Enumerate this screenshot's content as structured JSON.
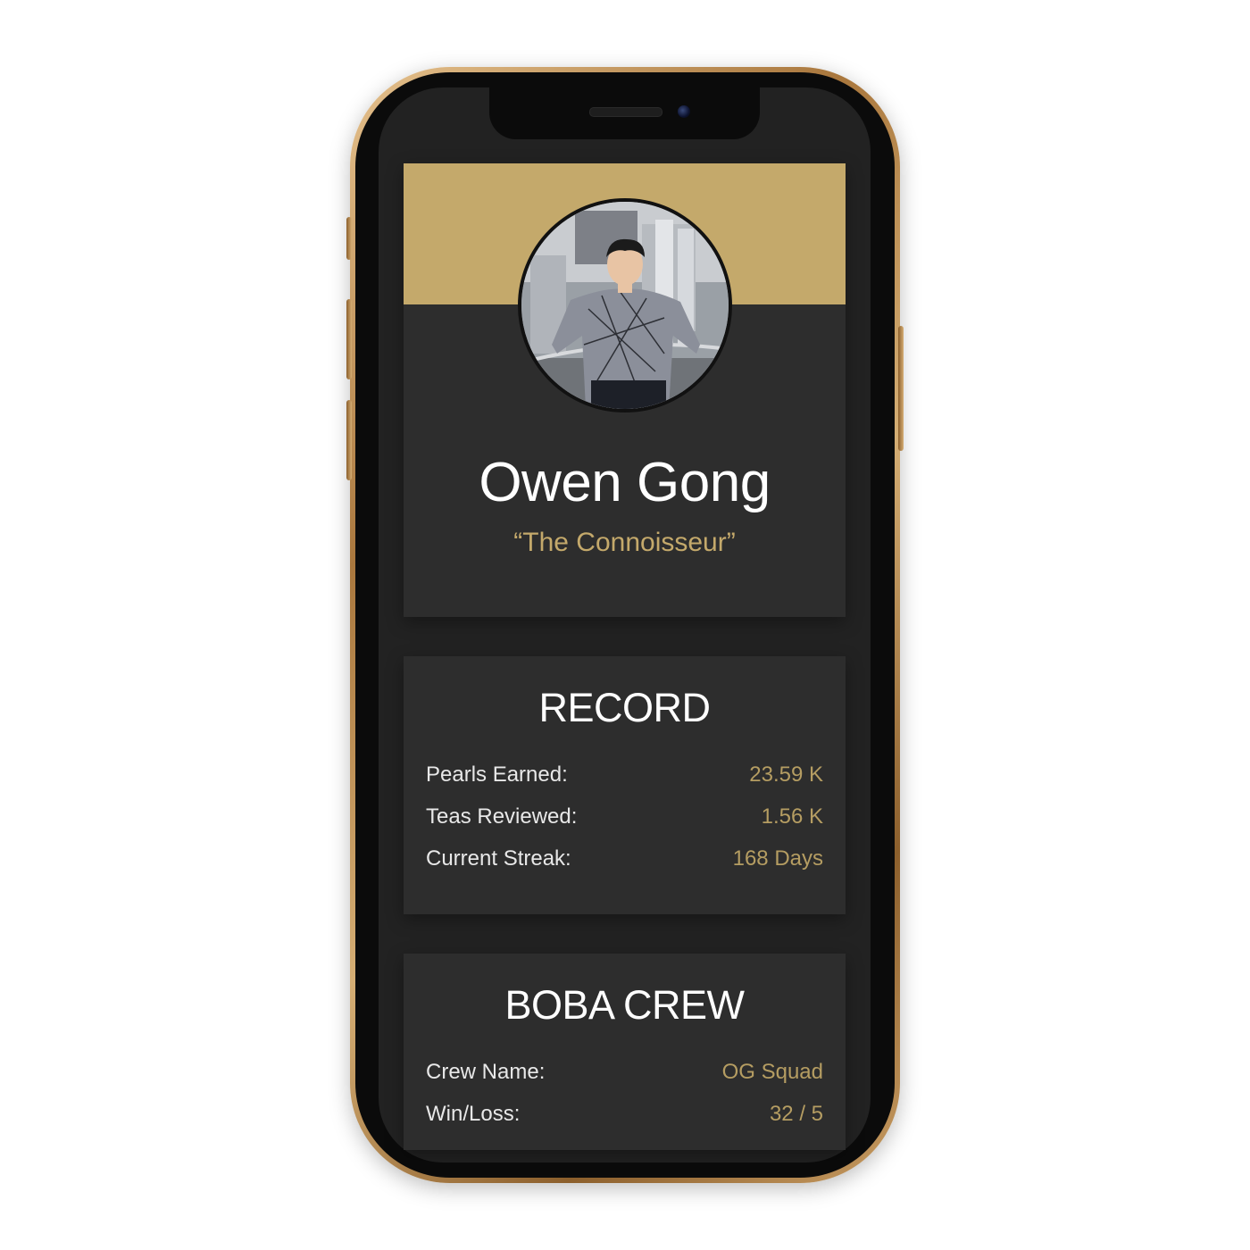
{
  "profile": {
    "name": "Owen Gong",
    "title": "“The Connoisseur”"
  },
  "record": {
    "heading": "RECORD",
    "stats": [
      {
        "label": "Pearls Earned:",
        "value": "23.59 K"
      },
      {
        "label": "Teas Reviewed:",
        "value": "1.56 K"
      },
      {
        "label": "Current Streak:",
        "value": "168 Days"
      }
    ]
  },
  "crew": {
    "heading": "BOBA CREW",
    "stats": [
      {
        "label": "Crew Name:",
        "value": "OG Squad"
      },
      {
        "label": "Win/Loss:",
        "value": "32 / 5"
      }
    ]
  },
  "colors": {
    "accent": "#c4a96b",
    "card": "#2d2d2d",
    "background": "#222222",
    "value_text": "#b59d62"
  }
}
